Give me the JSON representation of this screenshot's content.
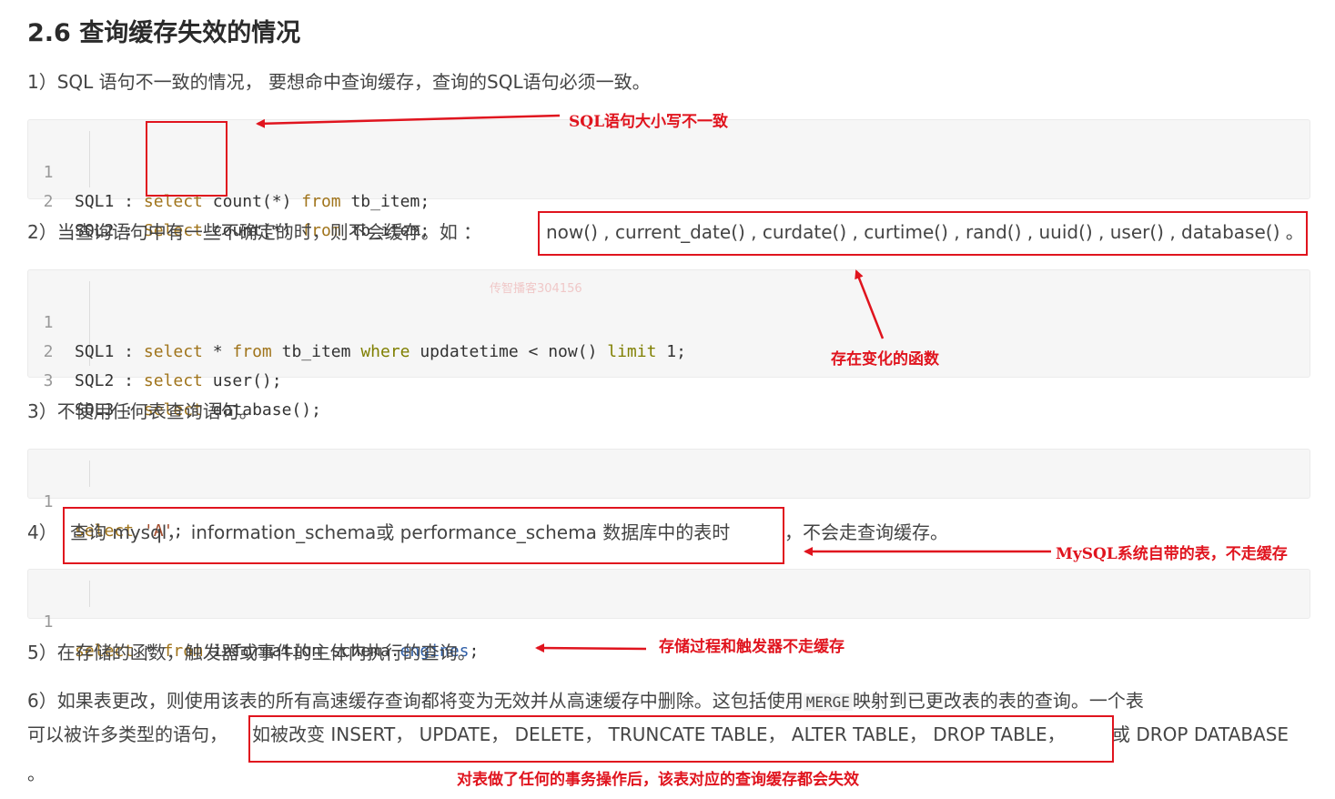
{
  "heading": "2.6 查询缓存失效的情况",
  "p1": "1）SQL 语句不一致的情况， 要想命中查询缓存，查询的SQL语句必须一致。",
  "code1": [
    {
      "ln": "1",
      "pre": "SQL1 : ",
      "kw": "select",
      "rest": " count(*) ",
      "from": "from",
      "tail": " tb_item;"
    },
    {
      "ln": "2",
      "pre": "SQL2 : ",
      "kw": "Select",
      "rest": " count(*) ",
      "from": "from",
      "tail": " tb_item;"
    }
  ],
  "anno1": "SQL语句大小写不一致",
  "p2_prefix": "2）当查询语句中有一些不确定的时，则不会缓存。如 ：",
  "p2_funcs": "now() , current_date() , curdate() , curtime() , rand() , uuid() , user() , database() 。",
  "code2": [
    {
      "ln": "1",
      "text_a": "SQL1 : ",
      "kw": "select",
      "text_b": " * ",
      "from": "from",
      "text_c": " tb_item ",
      "where": "where",
      "text_d": " updatetime < now() ",
      "limit": "limit",
      "text_e": " 1;"
    },
    {
      "ln": "2",
      "text_a": "SQL2 : ",
      "kw": "select",
      "text_b": " user();"
    },
    {
      "ln": "3",
      "text_a": "SQL3 : ",
      "kw": "select",
      "text_b": " database();"
    }
  ],
  "watermark": "传智播客304156",
  "anno2": "存在变化的函数",
  "p3": "3）不使用任何表查询语句。",
  "code3": {
    "ln": "1",
    "kw": "select",
    "str": " 'A'",
    "tail": ";"
  },
  "p4_box": "查询 mysql， information_schema或 performance_schema 数据库中的表时",
  "p4_tail": "，不会走查询缓存。",
  "p4_prefix": "4）",
  "anno4": "MySQL系统自带的表，不走缓存",
  "code4": {
    "ln": "1",
    "kw": "select",
    "b": " * ",
    "from": "from",
    "c": " information_schema.",
    "prop": "engines",
    "d": ";"
  },
  "p5": "5）在存储的函数，触发器或事件的主体内执行的查询。",
  "anno5": "存储过程和触发器不走缓存",
  "p6_a": "6）如果表更改，则使用该表的所有高速缓存查询都将变为无效并从高速缓存中删除。这包括使用",
  "p6_code": "MERGE",
  "p6_b": "映射到已更改表的表的查询。一个表",
  "p6_c": "可以被许多类型的语句，",
  "p6_box": "如被改变 INSERT， UPDATE， DELETE， TRUNCATE TABLE， ALTER TABLE， DROP TABLE，",
  "p6_d": "或 DROP DATABASE",
  "p6_e": "。",
  "anno6": "对表做了任何的事务操作后，该表对应的查询缓存都会失效",
  "colors": {
    "annotation": "#e0141e",
    "code_bg": "#f6f6f6"
  }
}
